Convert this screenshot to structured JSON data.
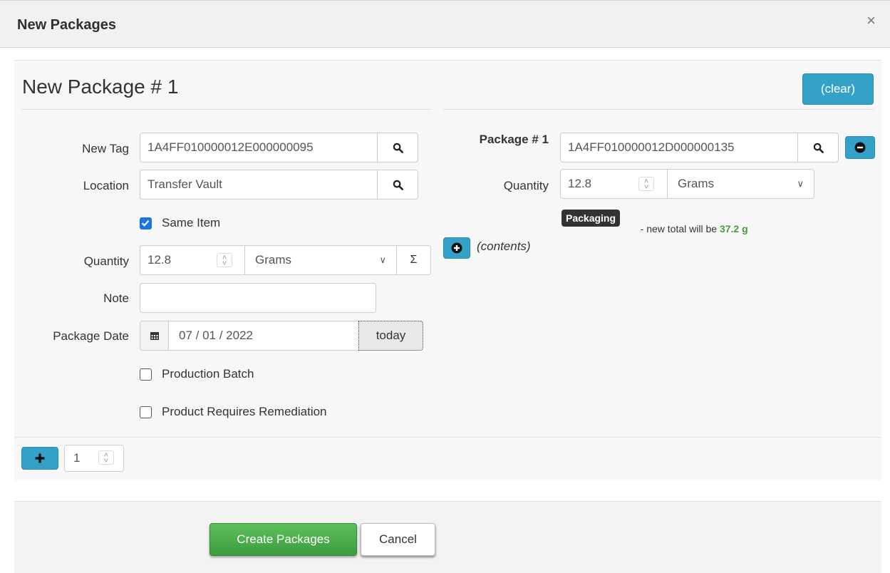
{
  "dialog": {
    "title": "New Packages",
    "close": "×"
  },
  "package": {
    "title": "New Package # 1",
    "clear_label": "(clear)",
    "new_tag": {
      "label": "New Tag",
      "value": "1A4FF010000012E000000095"
    },
    "location": {
      "label": "Location",
      "value": "Transfer Vault"
    },
    "same_item": {
      "label": "Same Item",
      "checked": true
    },
    "quantity": {
      "label": "Quantity",
      "value": "12.8",
      "unit": "Grams",
      "sum": "Σ"
    },
    "note": {
      "label": "Note",
      "value": ""
    },
    "package_date": {
      "label": "Package Date",
      "value": "07 / 01 / 2022",
      "today": "today"
    },
    "production_batch": {
      "label": "Production Batch",
      "checked": false
    },
    "remediation": {
      "label": "Product Requires Remediation",
      "checked": false
    }
  },
  "source": {
    "label": "Package # 1",
    "tag": "1A4FF010000012D000000135",
    "quantity_label": "Quantity",
    "quantity": "12.8",
    "unit": "Grams",
    "badge": "Packaging",
    "total_text": " - new total will be ",
    "total_value": "37.2 g",
    "contents": "(contents)"
  },
  "add_row": {
    "count": "1"
  },
  "footer": {
    "create": "Create Packages",
    "cancel": "Cancel"
  }
}
